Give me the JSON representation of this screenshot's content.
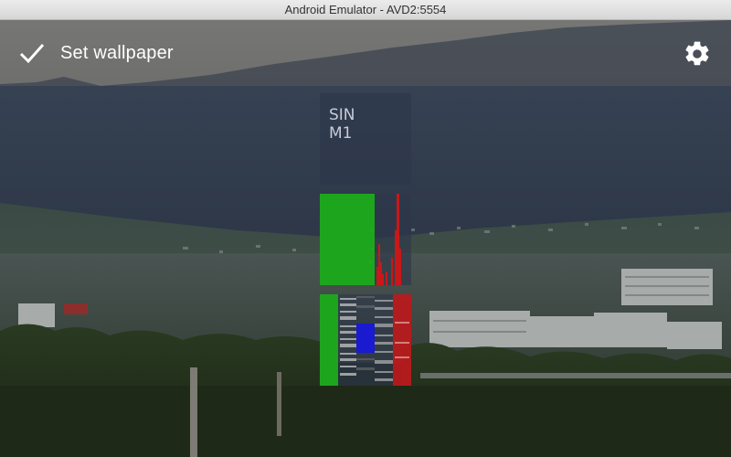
{
  "window": {
    "title": "Android Emulator - AVD2:5554"
  },
  "action_bar": {
    "confirm_label": "Set wallpaper",
    "confirm_icon": "check-icon",
    "settings_icon": "gear-icon"
  },
  "preview": {
    "text_widget": {
      "line1": "SIN",
      "line2": "M1"
    }
  },
  "colors": {
    "accent_green": "#1ea51e",
    "accent_red": "#c81818",
    "accent_blue": "#1a1ad0"
  }
}
